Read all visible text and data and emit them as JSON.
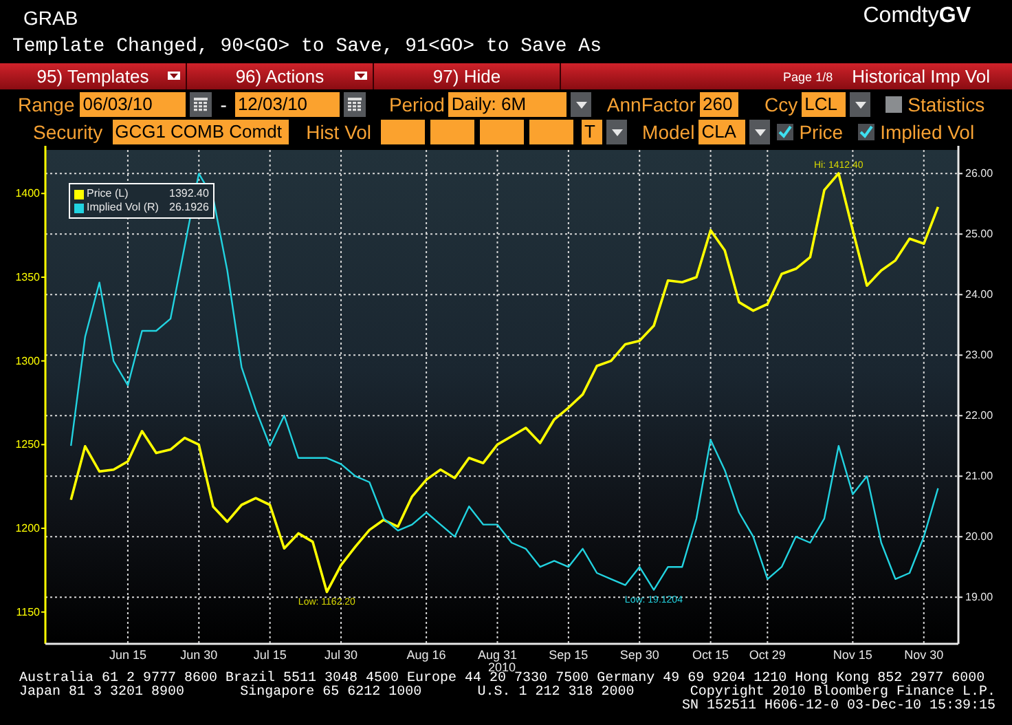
{
  "header": {
    "function": "GRAB",
    "title": "Comdty**GV**"
  },
  "message": "Template Changed, 90<GO> to Save, 91<GO> to Save As",
  "menu_bar": {
    "buttons": [
      {
        "label": "95) Templates",
        "dropdown": true
      },
      {
        "label": "96) Actions",
        "dropdown": true
      },
      {
        "label": "97) Hide",
        "dropdown": false
      }
    ],
    "page": "Page 1/8",
    "title": "Historical Imp Vol"
  },
  "range": {
    "label": "Range",
    "start": "06/03/10",
    "separator": "-",
    "end": "12/03/10"
  },
  "period": {
    "label": "Period",
    "value": "Daily: 6M"
  },
  "ann_factor": {
    "label": "AnnFactor",
    "value": "260"
  },
  "currency": {
    "label": "Ccy",
    "value": "LCL"
  },
  "statistics": {
    "label": "Statistics",
    "checked": false
  },
  "security": {
    "label": "Security",
    "value": "GCG1 COMB Comdt"
  },
  "hist_vol": {
    "label": "Hist Vol",
    "type": "T"
  },
  "model": {
    "label": "Model",
    "value": "CLA"
  },
  "price_toggle": {
    "label": "Price",
    "checked": true
  },
  "implied_vol_toggle": {
    "label": "Implied Vol",
    "checked": true
  },
  "legend": [
    {
      "value": "1392.40"
    },
    {
      "value": "26.1926"
    }
  ],
  "chart": {
    "chart_data": {
      "type": "line",
      "xlabel": "2010",
      "categories": [
        null,
        null,
        null,
        null,
        "Jun 15",
        null,
        null,
        null,
        null,
        "Jun 30",
        null,
        null,
        null,
        null,
        "Jul 15",
        null,
        null,
        null,
        null,
        "Jul 30",
        null,
        null,
        null,
        null,
        null,
        "Aug 16",
        null,
        null,
        null,
        null,
        "Aug 31",
        null,
        null,
        null,
        null,
        "Sep 15",
        null,
        null,
        null,
        null,
        "Sep 30",
        null,
        null,
        null,
        null,
        "Oct 15",
        null,
        null,
        null,
        "Oct 29",
        null,
        null,
        null,
        null,
        null,
        "Nov 15",
        null,
        null,
        null,
        null,
        "Nov 30",
        null
      ],
      "ylim": [
        1131,
        1426
      ],
      "y2lim": [
        18.23,
        26.39
      ],
      "grid": true,
      "legend": "upper left",
      "yticks": [
        1150,
        1200,
        1250,
        1300,
        1350,
        1400
      ],
      "y2ticks": [
        {
          "value": 19,
          "label": "19.00"
        },
        {
          "value": 20,
          "label": "20.00"
        },
        {
          "value": 21,
          "label": "21.00"
        },
        {
          "value": 22,
          "label": "22.00"
        },
        {
          "value": 23,
          "label": "23.00"
        },
        {
          "value": 24,
          "label": "24.00"
        },
        {
          "value": 25,
          "label": "25.00"
        },
        {
          "value": 26,
          "label": "26.00"
        }
      ],
      "series": [
        {
          "name": "Price (L)",
          "color": "#ffff00",
          "values": [
            1217,
            1249,
            1234,
            1235,
            1240,
            1258,
            1245,
            1247,
            1254,
            1250,
            1213,
            1204,
            1214,
            1218,
            1214,
            1188,
            1197,
            1192,
            1162,
            1178,
            1189,
            1199,
            1205,
            1201,
            1219,
            1229,
            1235,
            1230,
            1242,
            1239,
            1250,
            1255,
            1260,
            1251,
            1265,
            1272,
            1280,
            1297,
            1300,
            1310,
            1312,
            1321,
            1348,
            1347,
            1350,
            1378,
            1366,
            1335,
            1330,
            1334,
            1352,
            1355,
            1362,
            1402,
            1412,
            1378,
            1345,
            1354,
            1360,
            1373,
            1370,
            1392
          ]
        },
        {
          "name": "Implied Vol (R)",
          "axis": "y2",
          "color": "#22d3e0",
          "values": [
            21.5,
            23.3,
            24.2,
            22.9,
            22.5,
            23.4,
            23.4,
            23.6,
            24.8,
            26.0,
            25.6,
            24.4,
            22.8,
            22.1,
            21.5,
            22.0,
            21.3,
            21.3,
            21.3,
            21.2,
            21.0,
            20.9,
            20.3,
            20.1,
            20.2,
            20.4,
            20.2,
            20.0,
            20.5,
            20.2,
            20.2,
            19.9,
            19.8,
            19.5,
            19.6,
            19.5,
            19.8,
            19.4,
            19.3,
            19.2,
            19.5,
            19.12,
            19.5,
            19.5,
            20.3,
            21.6,
            21.1,
            20.4,
            20.0,
            19.3,
            19.5,
            20.0,
            19.9,
            20.3,
            21.5,
            20.7,
            21.0,
            19.9,
            19.3,
            19.4,
            20.0,
            20.8
          ]
        }
      ],
      "annotations": [
        "Hi: 1412.40",
        "Low: 1162.20",
        "Low: 19.1204"
      ]
    }
  },
  "footer": {
    "line_1": "Australia 61 2 9777 8600 Brazil 5511 3048 4500 Europe 44 20 7330 7500 Germany 49 69 9204 1210 Hong Kong 852 2977 6000",
    "line_2": [
      "Japan 81 3 3201 8900",
      "Singapore 65 6212 1000",
      "U.S. 1 212 318 2000",
      "Copyright 2010 Bloomberg Finance L.P."
    ],
    "line_3": "SN 152511 H606-12-0 03-Dec-10 15:39:15"
  }
}
